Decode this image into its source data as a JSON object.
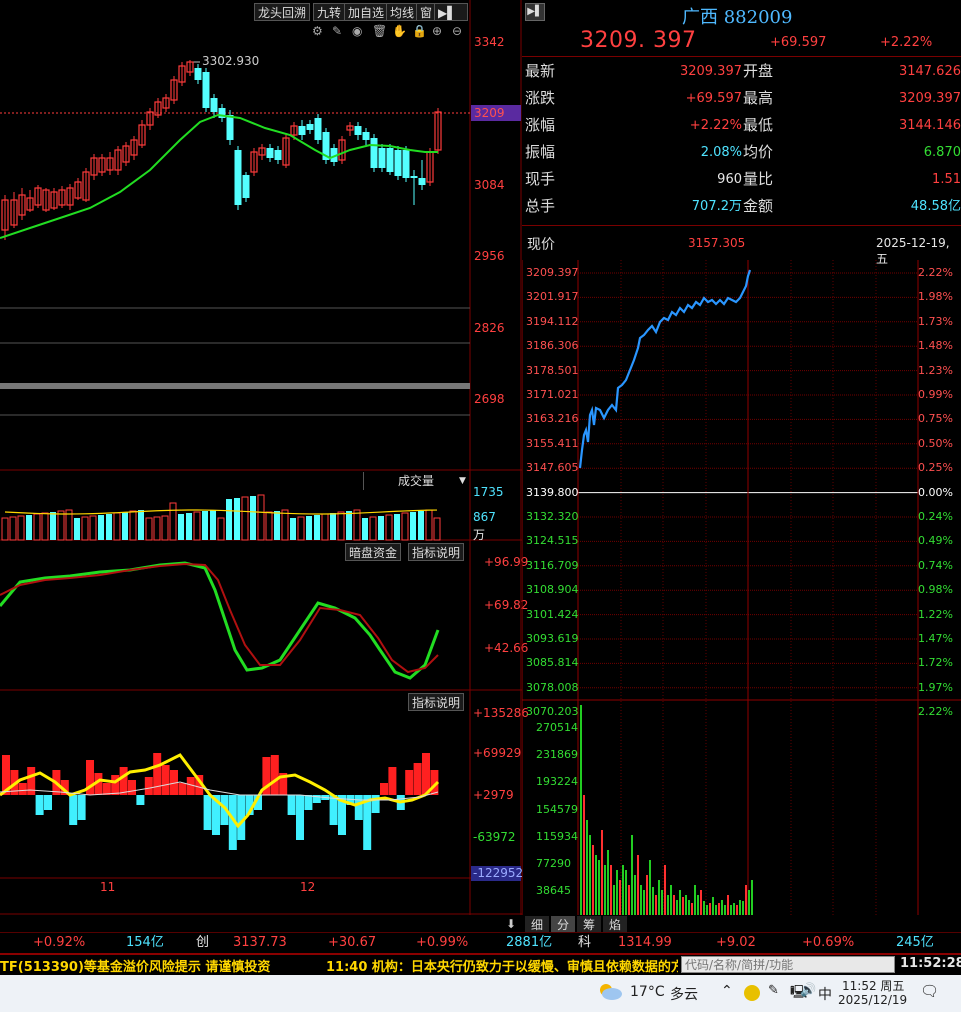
{
  "toolbar": {
    "buttons": [
      "龙头回溯",
      "九转",
      "加自选",
      "均线",
      "窗"
    ],
    "arrow_btn": "▶▌"
  },
  "kline": {
    "annotation_high": "3302.930",
    "price_ticks": [
      "3342",
      "3209",
      "3084",
      "2956",
      "2826",
      "2698"
    ],
    "current_label": "3209",
    "date_labels": [
      "11",
      "12"
    ]
  },
  "volume": {
    "selector_label": "成交量",
    "ticks": [
      "1735",
      "867"
    ],
    "unit": "万"
  },
  "indicator1": {
    "tab_label": "暗盘资金",
    "help_label": "指标说明",
    "ticks": [
      "+96.99",
      "+69.82",
      "+42.66"
    ]
  },
  "indicator2": {
    "help_label": "指标说明",
    "ticks": [
      "+135286",
      "+69929",
      "+2979",
      "-63972",
      "-122952"
    ]
  },
  "quote": {
    "title": "广西 882009",
    "price": "3209. 397",
    "change": "+69.597",
    "change_pct": "+2.22%",
    "rows": [
      {
        "l1": "最新",
        "v1": "3209.397",
        "c1": "red",
        "l2": "开盘",
        "v2": "3147.626",
        "c2": "red"
      },
      {
        "l1": "涨跌",
        "v1": "+69.597",
        "c1": "red",
        "l2": "最高",
        "v2": "3209.397",
        "c2": "red"
      },
      {
        "l1": "涨幅",
        "v1": "+2.22%",
        "c1": "red",
        "l2": "最低",
        "v2": "3144.146",
        "c2": "red"
      },
      {
        "l1": "振幅",
        "v1": "2.08%",
        "c1": "cyan",
        "l2": "均价",
        "v2": "6.870",
        "c2": "green"
      },
      {
        "l1": "现手",
        "v1": "960",
        "c1": "white",
        "l2": "量比",
        "v2": "1.51",
        "c2": "red"
      },
      {
        "l1": "总手",
        "v1": "707.2万",
        "c1": "cyan",
        "l2": "金额",
        "v2": "48.58亿",
        "c2": "cyan"
      }
    ],
    "cursor_label": "现价",
    "cursor_value": "3157.305",
    "date": "2025-12-19,五"
  },
  "intraday": {
    "price_left": [
      "3209.397",
      "3201.917",
      "3194.112",
      "3186.306",
      "3178.501",
      "3171.021",
      "3163.216",
      "3155.411",
      "3147.605",
      "3139.800",
      "3132.320",
      "3124.515",
      "3116.709",
      "3108.904",
      "3101.424",
      "3093.619",
      "3085.814",
      "3078.008",
      "3070.203"
    ],
    "pct_right": [
      "2.22%",
      "1.98%",
      "1.73%",
      "1.48%",
      "1.23%",
      "0.99%",
      "0.75%",
      "0.50%",
      "0.25%",
      "0.00%",
      "0.24%",
      "0.49%",
      "0.74%",
      "0.98%",
      "1.22%",
      "1.47%",
      "1.72%",
      "1.97%",
      "2.22%"
    ],
    "vol_ticks": [
      "270514",
      "231869",
      "193224",
      "154579",
      "115934",
      "77290",
      "38645"
    ],
    "tabs": [
      "细",
      "分",
      "筹",
      "焰"
    ]
  },
  "bottom_bar": {
    "pct1": "+0.92%",
    "amt1": "154亿",
    "board_name": "创",
    "board_index": "3137.73",
    "board_change": "+30.67",
    "board_pct": "+0.99%",
    "board_amt": "2881亿",
    "board2_name": "科",
    "board2_index": "1314.99",
    "board2_change": "+9.02",
    "board2_pct": "+0.69%",
    "board2_amt": "245亿"
  },
  "news_ticker": {
    "item1": "TF(513390)等基金溢价风险提示 请谨慎投资",
    "item2": "11:40 机构：日本央行仍致力于以缓慢、审慎且依赖数据的方",
    "search_placeholder": "代码/名称/简拼/功能",
    "clock": "11:52:28"
  },
  "taskbar": {
    "temperature": "17°C",
    "weather": "多云",
    "ime": "中",
    "time": "11:52 周五",
    "date": "2025/12/19"
  },
  "colors": {
    "up": "#ff3b3b",
    "down": "#54ffff",
    "ma_green": "#22dd22",
    "intraday_line": "#2a96ff",
    "grid_red": "#6b0000"
  }
}
